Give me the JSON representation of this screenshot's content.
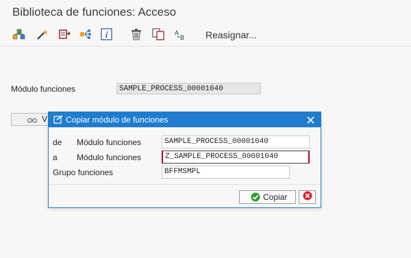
{
  "window": {
    "title": "Biblioteca de funciones: Acceso"
  },
  "toolbar": {
    "icons": [
      "hierarchy-icon",
      "magic-wand-icon",
      "display-change-icon",
      "where-used-icon",
      "info-icon",
      "trash-icon",
      "copy-icon",
      "rename-icon"
    ],
    "reassign_label": "Reasignar..."
  },
  "main": {
    "module_label": "Módulo funciones",
    "module_value": "SAMPLE_PROCESS_00001040",
    "button_label": "V"
  },
  "dialog": {
    "title": "Copiar módulo de funciones",
    "from_prefix": "de",
    "from_label": "Módulo funciones",
    "from_value": "SAMPLE_PROCESS_00001040",
    "to_prefix": "a",
    "to_label": "Módulo funciones",
    "to_value": "Z_SAMPLE_PROCESS_00001040",
    "group_label": "Grupo funciones",
    "group_value": "BFFMSMPL",
    "copy_button": "Copiar"
  },
  "colors": {
    "dialog_header": "#1f7ccf",
    "confirm_green": "#2e9d2e",
    "cancel_red": "#d9262b"
  }
}
